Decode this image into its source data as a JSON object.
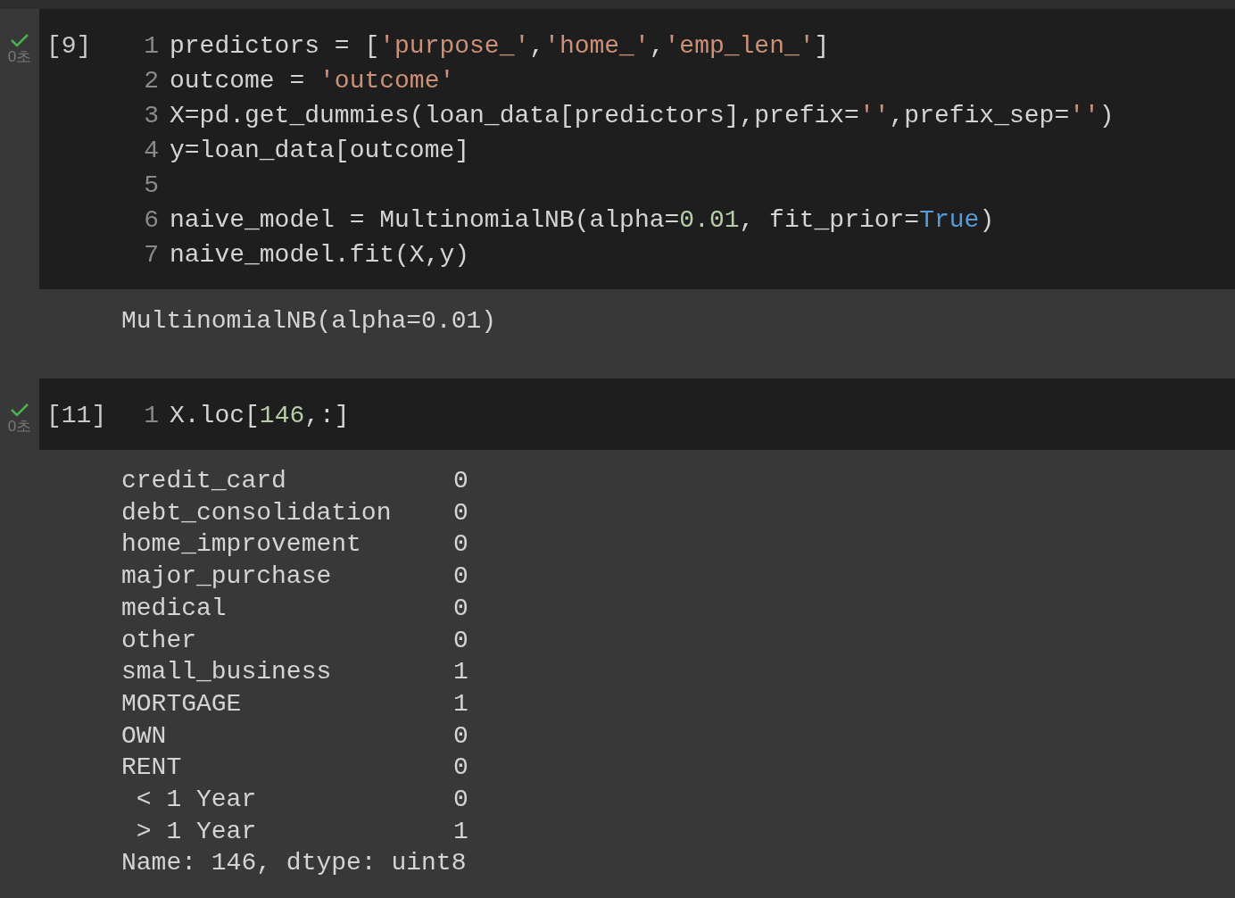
{
  "cells": [
    {
      "count": "[9]",
      "succeeded": true,
      "time": "0초",
      "lines": [
        {
          "number": "1",
          "tokens": [
            {
              "text": "predictors = [",
              "kind": "plain"
            },
            {
              "text": "'purpose_'",
              "kind": "string"
            },
            {
              "text": ",",
              "kind": "plain"
            },
            {
              "text": "'home_'",
              "kind": "string"
            },
            {
              "text": ",",
              "kind": "plain"
            },
            {
              "text": "'emp_len_'",
              "kind": "string"
            },
            {
              "text": "]",
              "kind": "plain"
            }
          ]
        },
        {
          "number": "2",
          "tokens": [
            {
              "text": "outcome = ",
              "kind": "plain"
            },
            {
              "text": "'outcome'",
              "kind": "string"
            }
          ]
        },
        {
          "number": "3",
          "tokens": [
            {
              "text": "X=pd.get_dummies(loan_data[predictors],prefix=",
              "kind": "plain"
            },
            {
              "text": "''",
              "kind": "string"
            },
            {
              "text": ",prefix_sep=",
              "kind": "plain"
            },
            {
              "text": "''",
              "kind": "string"
            },
            {
              "text": ")",
              "kind": "plain"
            }
          ]
        },
        {
          "number": "4",
          "tokens": [
            {
              "text": "y=loan_data[outcome]",
              "kind": "plain"
            }
          ]
        },
        {
          "number": "5"
        },
        {
          "number": "6",
          "tokens": [
            {
              "text": "naive_model = MultinomialNB(alpha=",
              "kind": "plain"
            },
            {
              "text": "0.01",
              "kind": "number"
            },
            {
              "text": ", fit_prior=",
              "kind": "plain"
            },
            {
              "text": "True",
              "kind": "keyword"
            },
            {
              "text": ")",
              "kind": "plain"
            }
          ]
        },
        {
          "number": "7",
          "tokens": [
            {
              "text": "naive_model.fit(X,y)",
              "kind": "plain"
            }
          ]
        }
      ],
      "output": {
        "kind": "text",
        "text": "MultinomialNB(alpha=0.01)"
      }
    },
    {
      "count": "[11]",
      "succeeded": true,
      "time": "0초",
      "lines": [
        {
          "number": "1",
          "tokens": [
            {
              "text": "X.loc[",
              "kind": "plain"
            },
            {
              "text": "146",
              "kind": "number"
            },
            {
              "text": ",:]",
              "kind": "plain"
            }
          ]
        }
      ],
      "output": {
        "kind": "series",
        "rows": [
          {
            "label": "credit_card",
            "value": "0"
          },
          {
            "label": "debt_consolidation",
            "value": "0"
          },
          {
            "label": "home_improvement",
            "value": "0"
          },
          {
            "label": "major_purchase",
            "value": "0"
          },
          {
            "label": "medical",
            "value": "0"
          },
          {
            "label": "other",
            "value": "0"
          },
          {
            "label": "small_business",
            "value": "1"
          },
          {
            "label": "MORTGAGE",
            "value": "1"
          },
          {
            "label": "OWN",
            "value": "0"
          },
          {
            "label": "RENT",
            "value": "0"
          },
          {
            "label": " < 1 Year",
            "value": "0"
          },
          {
            "label": " > 1 Year",
            "value": "1"
          }
        ],
        "footer": "Name: 146, dtype: uint8"
      }
    }
  ]
}
